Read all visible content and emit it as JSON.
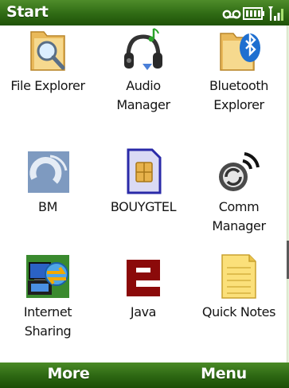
{
  "titlebar": {
    "title": "Start"
  },
  "status_icons": [
    "voicemail-icon",
    "battery-icon",
    "signal-icon"
  ],
  "apps": [
    {
      "label": "File Explorer",
      "icon": "folder-magnifier-icon"
    },
    {
      "label": "Audio\nManager",
      "icon": "headphones-note-icon"
    },
    {
      "label": "Bluetooth\nExplorer",
      "icon": "bluetooth-folder-icon"
    },
    {
      "label": "BM",
      "icon": "bm-icon"
    },
    {
      "label": "BOUYGTEL",
      "icon": "sim-card-icon"
    },
    {
      "label": "Comm\nManager",
      "icon": "comm-manager-icon"
    },
    {
      "label": "Internet\nSharing",
      "icon": "internet-sharing-icon"
    },
    {
      "label": "Java",
      "icon": "java-icon"
    },
    {
      "label": "Quick Notes",
      "icon": "notepad-icon"
    }
  ],
  "softkeys": {
    "left": "More",
    "right": "Menu"
  },
  "colors": {
    "bar_green": "#2f6a14",
    "accent_blue": "#1e6fd0"
  }
}
